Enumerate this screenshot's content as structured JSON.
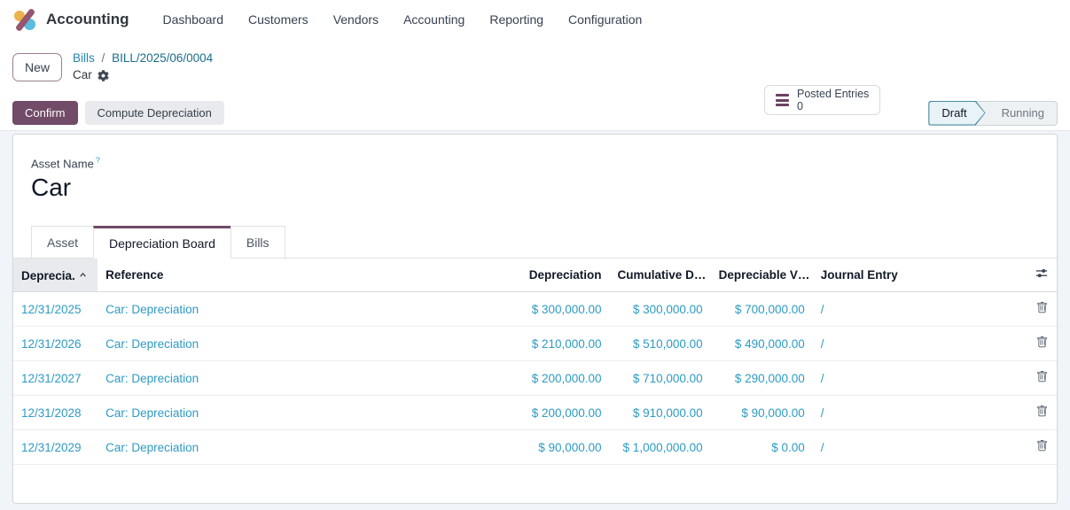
{
  "colors": {
    "primary": "#714B67",
    "table_link": "#2d9bc4",
    "breadcrumb_link": "#2187A8",
    "draft_fill": "#e8f3f7",
    "draft_border": "#4a8ba1",
    "logo_yellow": "#ECB24C",
    "logo_blue": "#59BDE0",
    "logo_slash": "#96566F"
  },
  "nav": {
    "app_name": "Accounting",
    "items": [
      {
        "label": "Dashboard"
      },
      {
        "label": "Customers"
      },
      {
        "label": "Vendors"
      },
      {
        "label": "Accounting"
      },
      {
        "label": "Reporting"
      },
      {
        "label": "Configuration"
      }
    ]
  },
  "control_panel": {
    "new_button": "New",
    "breadcrumb": {
      "parent": "Bills",
      "separator": "/",
      "document": "BILL/2025/06/0004",
      "current": "Car"
    },
    "stat_button": {
      "label": "Posted Entries",
      "value": "0"
    }
  },
  "statusbar": {
    "confirm_button": "Confirm",
    "compute_button": "Compute Depreciation",
    "states": {
      "draft": "Draft",
      "running": "Running"
    }
  },
  "form": {
    "asset_name_label": "Asset Name",
    "help_marker": "?",
    "asset_name_value": "Car",
    "tabs": [
      {
        "label": "Asset",
        "active": false
      },
      {
        "label": "Depreciation Board",
        "active": true
      },
      {
        "label": "Bills",
        "active": false
      }
    ]
  },
  "board": {
    "headers": {
      "date": "Deprecia.",
      "reference": "Reference",
      "depreciation": "Depreciation",
      "cumulative": "Cumulative D…",
      "depreciable": "Depreciable V…",
      "journal": "Journal Entry"
    },
    "rows": [
      {
        "date": "12/31/2025",
        "reference": "Car: Depreciation",
        "depreciation": "$ 300,000.00",
        "cumulative": "$ 300,000.00",
        "depreciable": "$ 700,000.00",
        "journal": "/"
      },
      {
        "date": "12/31/2026",
        "reference": "Car: Depreciation",
        "depreciation": "$ 210,000.00",
        "cumulative": "$ 510,000.00",
        "depreciable": "$ 490,000.00",
        "journal": "/"
      },
      {
        "date": "12/31/2027",
        "reference": "Car: Depreciation",
        "depreciation": "$ 200,000.00",
        "cumulative": "$ 710,000.00",
        "depreciable": "$ 290,000.00",
        "journal": "/"
      },
      {
        "date": "12/31/2028",
        "reference": "Car: Depreciation",
        "depreciation": "$ 200,000.00",
        "cumulative": "$ 910,000.00",
        "depreciable": "$ 90,000.00",
        "journal": "/"
      },
      {
        "date": "12/31/2029",
        "reference": "Car: Depreciation",
        "depreciation": "$ 90,000.00",
        "cumulative": "$ 1,000,000.00",
        "depreciable": "$ 0.00",
        "journal": "/"
      }
    ]
  }
}
